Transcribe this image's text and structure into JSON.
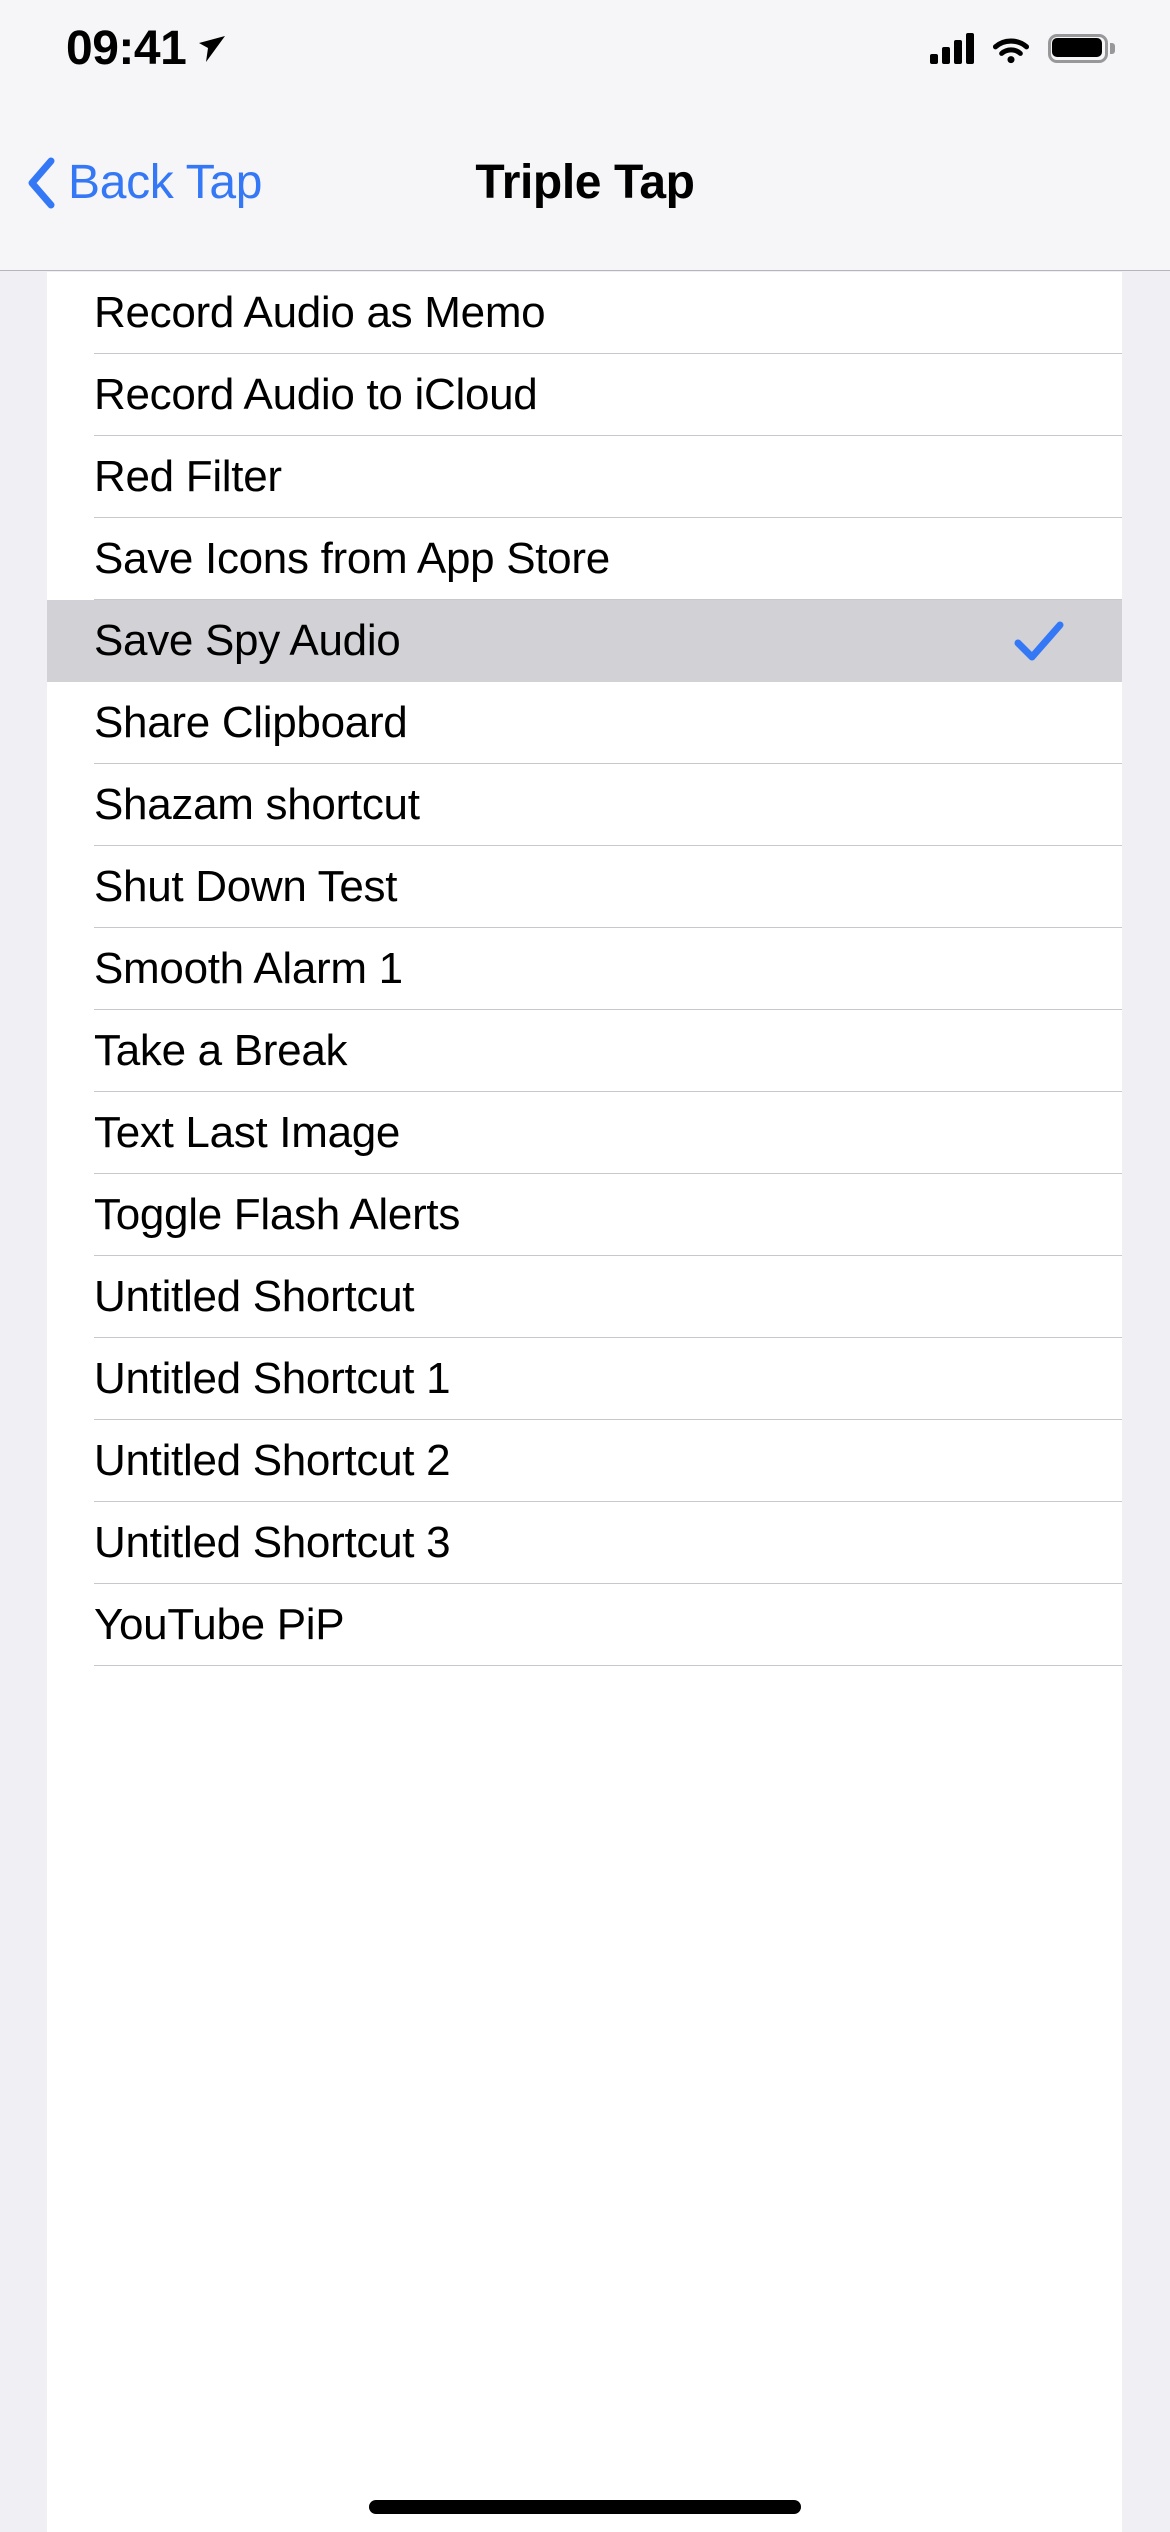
{
  "status_bar": {
    "time": "09:41",
    "location_icon": "location-arrow-icon",
    "cellular_icon": "cellular-signal-icon",
    "wifi_icon": "wifi-icon",
    "battery_icon": "battery-full-icon"
  },
  "nav_bar": {
    "back_icon": "chevron-left-icon",
    "back_label": "Back Tap",
    "title": "Triple Tap"
  },
  "list": {
    "selected_index": 4,
    "check_icon": "checkmark-icon",
    "rows": [
      {
        "label": "Record Audio as Memo",
        "selected": false
      },
      {
        "label": "Record Audio to iCloud",
        "selected": false
      },
      {
        "label": "Red Filter",
        "selected": false
      },
      {
        "label": "Save Icons from App Store",
        "selected": false
      },
      {
        "label": "Save Spy Audio",
        "selected": true
      },
      {
        "label": "Share Clipboard",
        "selected": false
      },
      {
        "label": "Shazam shortcut",
        "selected": false
      },
      {
        "label": "Shut Down Test",
        "selected": false
      },
      {
        "label": "Smooth Alarm 1",
        "selected": false
      },
      {
        "label": "Take a Break",
        "selected": false
      },
      {
        "label": "Text Last Image",
        "selected": false
      },
      {
        "label": "Toggle Flash Alerts",
        "selected": false
      },
      {
        "label": "Untitled Shortcut",
        "selected": false
      },
      {
        "label": "Untitled Shortcut 1",
        "selected": false
      },
      {
        "label": "Untitled Shortcut 2",
        "selected": false
      },
      {
        "label": "Untitled Shortcut 3",
        "selected": false
      },
      {
        "label": "YouTube PiP",
        "selected": false
      }
    ]
  },
  "home_indicator": {
    "name": "home-indicator"
  },
  "colors": {
    "accent_blue": "#3478F6",
    "selected_row_bg": "#D1D1D6",
    "separator": "#C8C7CC",
    "chrome_bg": "#F6F6F8",
    "backdrop": "#F0F0F4",
    "card_bg": "#FFFFFF",
    "text_primary": "#000000"
  }
}
